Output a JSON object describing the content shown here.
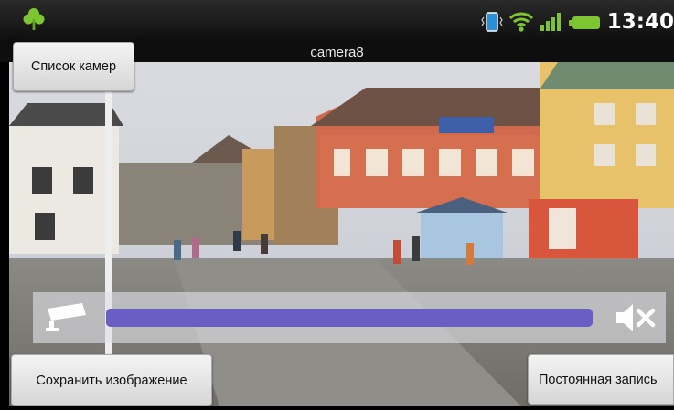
{
  "status_bar": {
    "time": "13:40",
    "icons": [
      "app-clover-icon",
      "vibrate-icon",
      "wifi-icon",
      "signal-icon",
      "battery-icon"
    ],
    "accent": "#7ec631"
  },
  "camera": {
    "name": "camera8"
  },
  "buttons": {
    "camera_list": "Список камер",
    "save_image": "Сохранить изображение",
    "constant_record": "Постоянная запись"
  },
  "controls": {
    "stream_icon": "cctv-camera-icon",
    "mute_icon": "speaker-muted-icon",
    "progress": 1.0,
    "progress_color": "#6a5ec2"
  }
}
